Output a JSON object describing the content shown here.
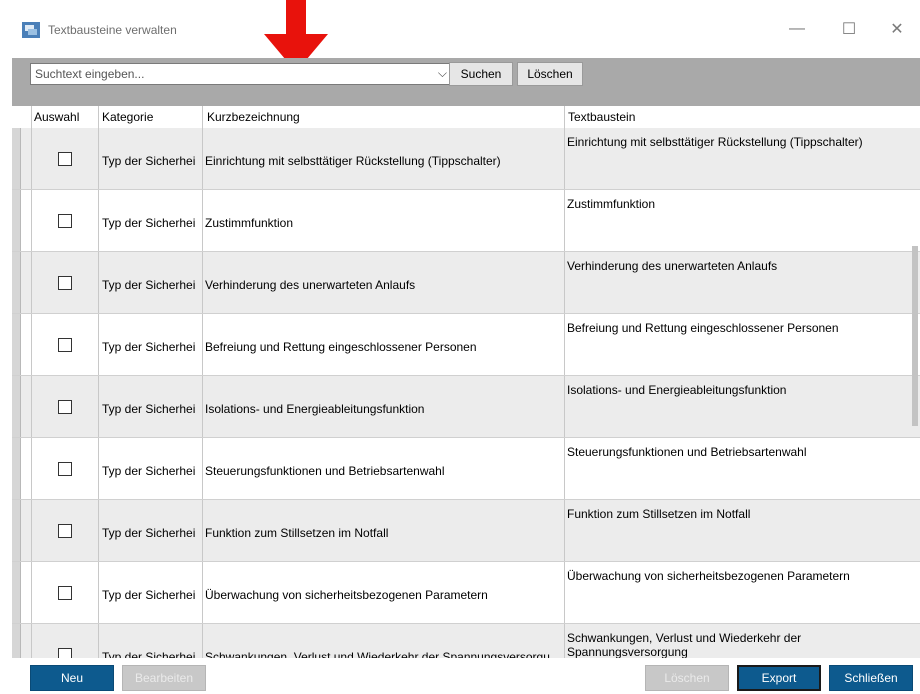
{
  "window": {
    "title": "Textbausteine verwalten",
    "minimize": "—",
    "maximize": "☐",
    "close": "✕"
  },
  "toolbar": {
    "search_placeholder": "Suchtext eingeben...",
    "search_button": "Suchen",
    "clear_button": "Löschen"
  },
  "columns": {
    "auswahl": "Auswahl",
    "kategorie": "Kategorie",
    "kurz": "Kurzbezeichnung",
    "textbaustein": "Textbaustein"
  },
  "rows": [
    {
      "kategorie": "Typ der Sicherhei",
      "kurz": "Einrichtung mit selbsttätiger Rückstellung (Tippschalter)",
      "text": "Einrichtung mit selbsttätiger Rückstellung (Tippschalter)"
    },
    {
      "kategorie": "Typ der Sicherhei",
      "kurz": "Zustimmfunktion",
      "text": "Zustimmfunktion"
    },
    {
      "kategorie": "Typ der Sicherhei",
      "kurz": "Verhinderung des unerwarteten Anlaufs",
      "text": "Verhinderung des unerwarteten Anlaufs"
    },
    {
      "kategorie": "Typ der Sicherhei",
      "kurz": "Befreiung und Rettung eingeschlossener Personen",
      "text": "Befreiung und Rettung eingeschlossener Personen"
    },
    {
      "kategorie": "Typ der Sicherhei",
      "kurz": "Isolations- und Energieableitungsfunktion",
      "text": "Isolations- und Energieableitungsfunktion"
    },
    {
      "kategorie": "Typ der Sicherhei",
      "kurz": "Steuerungsfunktionen und Betriebsartenwahl",
      "text": "Steuerungsfunktionen und Betriebsartenwahl"
    },
    {
      "kategorie": "Typ der Sicherhei",
      "kurz": "Funktion zum Stillsetzen im Notfall",
      "text": "Funktion zum Stillsetzen im Notfall"
    },
    {
      "kategorie": "Typ der Sicherhei",
      "kurz": "Überwachung von sicherheitsbezogenen Parametern",
      "text": "Überwachung von sicherheitsbezogenen Parametern"
    },
    {
      "kategorie": "Typ der Sicherhei",
      "kurz": "Schwankungen, Verlust und Wiederkehr der Spannungsversorgu",
      "text": "Schwankungen, Verlust und Wiederkehr der Spannungsversorgung"
    }
  ],
  "footer": {
    "new": "Neu",
    "edit": "Bearbeiten",
    "delete": "Löschen",
    "export": "Export",
    "close": "Schließen"
  },
  "colors": {
    "accent": "#0d5a8e",
    "toolbar": "#a9a9a9",
    "arrow": "#e8120c"
  }
}
